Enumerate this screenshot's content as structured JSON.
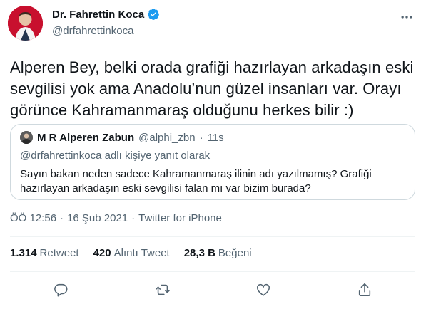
{
  "author": {
    "display_name": "Dr. Fahrettin Koca",
    "handle": "@drfahrettinkoca"
  },
  "tweet": {
    "text": "Alperen Bey, belki orada grafiği hazırlayan arkadaşın eski sevgilisi yok ama Anadolu’nun güzel insanları var. Orayı görünce Kahramanmaraş olduğunu herkes bilir :)"
  },
  "quoted": {
    "display_name": "M R Alperen Zabun",
    "handle": "@alphi_zbn",
    "separator": "·",
    "time": "11s",
    "reply_context": "@drfahrettinkoca adlı kişiye yanıt olarak",
    "text": "Sayın bakan neden sadece Kahramanmaraş ilinin adı yazılmamış? Grafiği hazırlayan arkadaşın eski sevgilisi falan mı var bizim burada?"
  },
  "meta": {
    "time": "ÖÖ 12:56",
    "separator": "·",
    "date": "16 Şub 2021",
    "separator2": "·",
    "source": "Twitter for iPhone"
  },
  "stats": [
    {
      "count": "1.314",
      "label": "Retweet"
    },
    {
      "count": "420",
      "label": "Alıntı Tweet"
    },
    {
      "count": "28,3 B",
      "label": "Beğeni"
    }
  ],
  "icons": {
    "verified": "verified-badge-icon",
    "more": "more-dots-icon",
    "reply": "reply-icon",
    "retweet": "retweet-icon",
    "like": "heart-icon",
    "share": "share-icon"
  },
  "colors": {
    "verified": "#1d9bf0",
    "icon": "#536471",
    "border": "#cfd9de",
    "avatar_bg": "#c8102e"
  }
}
